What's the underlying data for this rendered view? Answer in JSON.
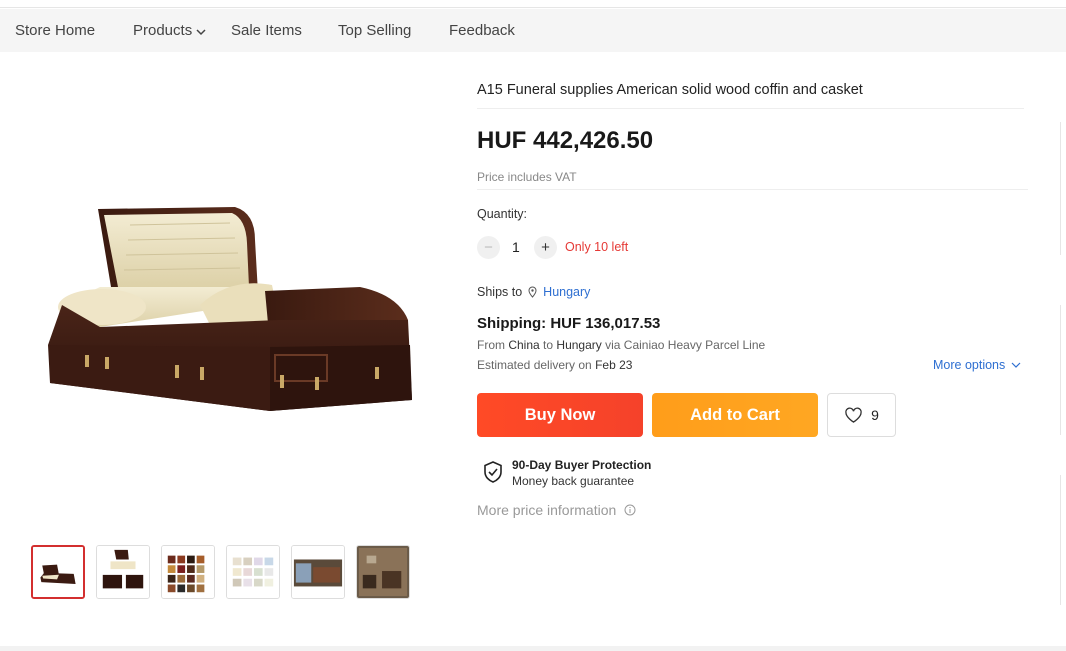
{
  "nav": {
    "items": [
      {
        "label": "Store Home"
      },
      {
        "label": "Products",
        "has_dropdown": true
      },
      {
        "label": "Sale Items"
      },
      {
        "label": "Top Selling"
      },
      {
        "label": "Feedback"
      }
    ]
  },
  "product": {
    "title": "A15 Funeral supplies American solid wood coffin and casket",
    "price": "HUF 442,426.50",
    "vat_note": "Price includes VAT",
    "main_image_icon": "casket-image",
    "thumbnails": [
      {
        "name": "thumbnail-casket-open",
        "active": true
      },
      {
        "name": "thumbnail-casket-views",
        "active": false
      },
      {
        "name": "thumbnail-color-swatches",
        "active": false
      },
      {
        "name": "thumbnail-interior-swatches",
        "active": false
      },
      {
        "name": "thumbnail-warehouse",
        "active": false
      },
      {
        "name": "thumbnail-factory",
        "active": false
      }
    ]
  },
  "quantity": {
    "label": "Quantity:",
    "value": "1",
    "minus": "−",
    "plus": "+",
    "stock_note": "Only 10 left"
  },
  "shipping": {
    "ships_to_label": "Ships to",
    "destination": "Hungary",
    "cost": "Shipping: HUF 136,017.53",
    "from_prefix": "From",
    "origin": "China",
    "to_word": "to",
    "to_dest": "Hungary",
    "via_text": "via Cainiao Heavy Parcel Line",
    "delivery_prefix": "Estimated delivery on",
    "delivery_date": "Feb 23",
    "more_options": "More options"
  },
  "actions": {
    "buy_now": "Buy Now",
    "add_to_cart": "Add to Cart",
    "wishlist_count": "9"
  },
  "protection": {
    "title": "90-Day Buyer Protection",
    "subtitle": "Money back guarantee"
  },
  "more_price_info": "More price information",
  "colors": {
    "buy": "#f5422a",
    "cart": "#ffa722",
    "link": "#2e6fd1",
    "stock": "#e53935",
    "active_thumb": "#d32f2f"
  }
}
